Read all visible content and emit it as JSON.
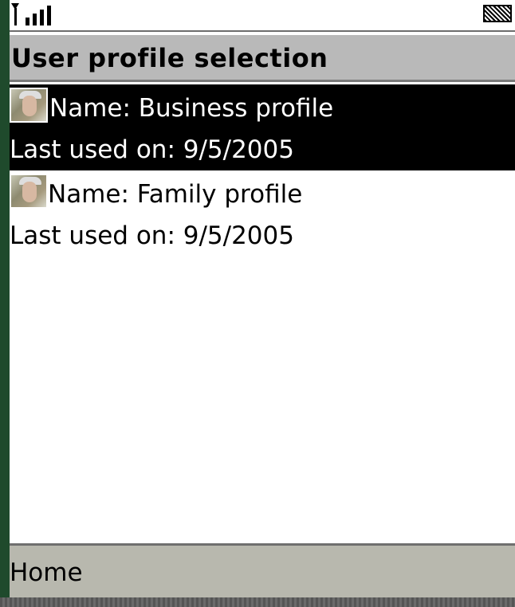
{
  "status": {
    "signal_icon": "signal-strength-icon",
    "battery_icon": "battery-icon"
  },
  "header": {
    "title": "User profile selection"
  },
  "profiles": [
    {
      "name": "Name: Business profile",
      "last_used": "Last used on: 9/5/2005",
      "selected": true,
      "avatar_icon": "avatar-icon"
    },
    {
      "name": "Name: Family profile",
      "last_used": "Last used on: 9/5/2005",
      "selected": false,
      "avatar_icon": "avatar-icon"
    }
  ],
  "softkeys": {
    "left_label": "Home"
  },
  "colors": {
    "selection_background": "#000000",
    "title_bar_background": "#b9b9b9",
    "softkey_bar_background": "#b8b8ae",
    "device_frame": "#1f4a2c"
  }
}
